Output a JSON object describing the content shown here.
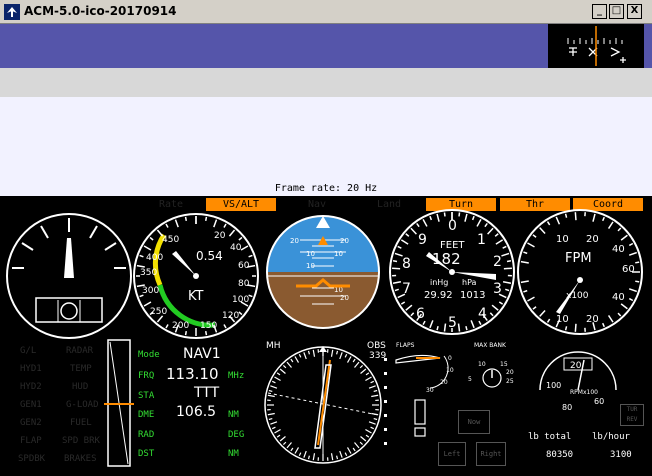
{
  "window": {
    "title": "ACM-5.0-ico-20170914",
    "buttons": {
      "minimize": "_",
      "maximize": "□",
      "close": "X"
    }
  },
  "hud": {
    "frame_rate": "Frame rate: 20 Hz"
  },
  "annunciators": [
    {
      "label": "Rate",
      "state": "off"
    },
    {
      "label": "VS/ALT",
      "state": "on"
    },
    {
      "label": "Nav",
      "state": "off"
    },
    {
      "label": "Land",
      "state": "off"
    },
    {
      "label": "Turn",
      "state": "on"
    },
    {
      "label": "Thr",
      "state": "on"
    },
    {
      "label": "Coord",
      "state": "on"
    }
  ],
  "airspeed": {
    "readout": "0.54",
    "unit": "KT",
    "ticks": [
      "450",
      "400",
      "350",
      "300",
      "250",
      "200",
      "150",
      "120",
      "100",
      "80",
      "60",
      "40",
      "20"
    ]
  },
  "attitude": {
    "pitch_labels": [
      "20",
      "10",
      "10",
      "20",
      "10",
      "10",
      "20"
    ]
  },
  "altimeter": {
    "unit": "FEET",
    "readout": "182",
    "pressure_label": "inHg",
    "pressure": "29.92",
    "units_label": "hPa",
    "hpa": "1013",
    "dial": [
      "0",
      "1",
      "2",
      "3",
      "4",
      "5",
      "6",
      "7",
      "8",
      "9"
    ]
  },
  "vsi": {
    "unit": "FPM",
    "multiplier": "x100",
    "ticks": [
      "10",
      "20",
      "40",
      "60",
      "40",
      "20",
      "10"
    ]
  },
  "switches": {
    "left": [
      "G/L",
      "HYD1",
      "HYD2",
      "GEN1",
      "GEN2",
      "FLAP",
      "SPDBK"
    ],
    "right": [
      "RADAR",
      "TEMP",
      "HUD",
      "G-LOAD",
      "FUEL",
      "SPD BRK",
      "BRAKES"
    ]
  },
  "nav": {
    "mode_label": "Mode",
    "mode": "NAV1",
    "frq_label": "FRQ",
    "frequency": "113.10",
    "frq_unit": "MHz",
    "sta_label": "STA",
    "station": "TTT",
    "dme_label": "DME",
    "dme": "106.5",
    "dme_unit": "NM",
    "rad_label": "RAD",
    "rad_unit": "DEG",
    "dst_label": "DST",
    "dst_unit": "NM"
  },
  "hsi": {
    "mh_label": "MH",
    "obs_label": "OBS",
    "obs": "339"
  },
  "flaps": {
    "label": "FLAPS",
    "ticks": [
      "0",
      "10",
      "20",
      "30"
    ]
  },
  "bank": {
    "label": "MAX BANK",
    "ticks": [
      "10",
      "15",
      "20",
      "25",
      "5"
    ]
  },
  "rpm": {
    "readout": "20",
    "label": "RPMx100",
    "ticks": [
      "100",
      "80",
      "60"
    ]
  },
  "buttons": {
    "now": "Now",
    "left": "Left",
    "right": "Right",
    "tur_rev": "TUR REV"
  },
  "fuel": {
    "total_label": "lb total",
    "total": "80350",
    "flow_label": "lb/hour",
    "flow": "3100"
  },
  "colors": {
    "annunciator_on": "#ff8c00",
    "nav_label_green": "#33dd33",
    "sky": "#3a92d8",
    "ground": "#8a5a30",
    "top_band": "#5555aa"
  }
}
